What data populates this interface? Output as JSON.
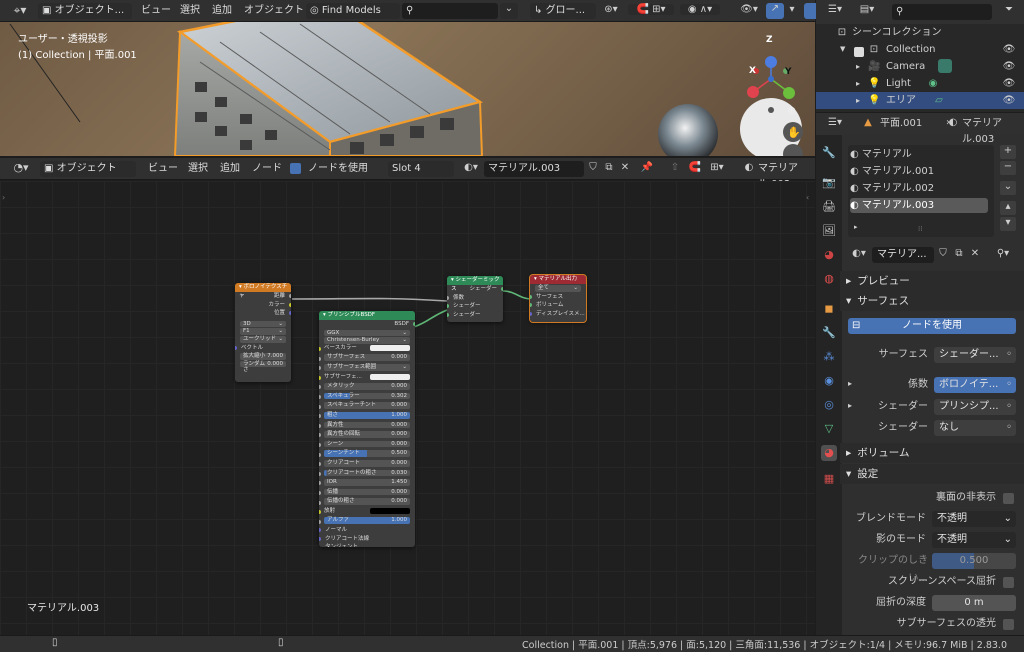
{
  "top_header": {
    "mode": "オブジェクト...",
    "menus": [
      "ビュー",
      "選択",
      "追加",
      "オブジェクト"
    ],
    "find_models": "Find Models",
    "transform": "グロー..."
  },
  "viewport": {
    "title": "ユーザー・透視投影",
    "collection": "(1) Collection | 平面.001",
    "gizmo_z": "Z",
    "gizmo_y": "Y",
    "gizmo_x": "X"
  },
  "node_header": {
    "mode": "オブジェクト",
    "menus": [
      "ビュー",
      "選択",
      "追加",
      "ノード"
    ],
    "use_nodes": "ノードを使用",
    "slot": "Slot 4",
    "material": "マテリアル.003",
    "material_right": "マテリアル.003"
  },
  "node_editor": {
    "material_label": "マテリアル.003",
    "voronoi": {
      "title": "ボロノイテクスチャ",
      "outputs": [
        "距離",
        "カラー",
        "位置"
      ],
      "dims": "3D",
      "metric": "F1",
      "distance": "ユークリッド",
      "vector": "ベクトル",
      "scale_label": "拡大縮小",
      "scale_value": "7.000",
      "random_label": "ランダムさ",
      "random_value": "0.000"
    },
    "mix": {
      "title": "シェーダーミックス",
      "output": "シェーダー",
      "inputs": [
        "係数",
        "シェーダー",
        "シェーダー"
      ]
    },
    "output": {
      "title": "マテリアル出力",
      "target": "全て",
      "inputs": [
        "サーフェス",
        "ボリューム",
        "ディスプレイスメ..."
      ]
    },
    "bsdf": {
      "title": "プリンシプルBSDF",
      "output": "BSDF",
      "dist": "GGX",
      "ss_method": "Christensen-Burley",
      "rows": [
        {
          "label": "ベースカラー",
          "value": "",
          "kind": "color",
          "fill": 0
        },
        {
          "label": "サブサーフェス",
          "value": "0.000",
          "kind": "num",
          "fill": 0
        },
        {
          "label": "サブサーフェス範囲",
          "value": "",
          "kind": "drop",
          "fill": 0
        },
        {
          "label": "サブサーフェ...",
          "value": "",
          "kind": "color",
          "fill": 0
        },
        {
          "label": "メタリック",
          "value": "0.000",
          "kind": "num",
          "fill": 0
        },
        {
          "label": "スペキュラー",
          "value": "0.302",
          "kind": "num",
          "fill": 30
        },
        {
          "label": "スペキュラーチント",
          "value": "0.000",
          "kind": "num",
          "fill": 0
        },
        {
          "label": "粗さ",
          "value": "1.000",
          "kind": "num",
          "fill": 100
        },
        {
          "label": "異方性",
          "value": "0.000",
          "kind": "num",
          "fill": 0
        },
        {
          "label": "異方性の回転",
          "value": "0.000",
          "kind": "num",
          "fill": 0
        },
        {
          "label": "シーン",
          "value": "0.000",
          "kind": "num",
          "fill": 0
        },
        {
          "label": "シーンチント",
          "value": "0.500",
          "kind": "num",
          "fill": 50
        },
        {
          "label": "クリアコート",
          "value": "0.000",
          "kind": "num",
          "fill": 0
        },
        {
          "label": "クリアコートの粗さ",
          "value": "0.030",
          "kind": "num",
          "fill": 3
        },
        {
          "label": "IOR",
          "value": "1.450",
          "kind": "num",
          "fill": 0
        },
        {
          "label": "伝播",
          "value": "0.000",
          "kind": "num",
          "fill": 0
        },
        {
          "label": "伝播の粗さ",
          "value": "0.000",
          "kind": "num",
          "fill": 0
        },
        {
          "label": "放射",
          "value": "",
          "kind": "black",
          "fill": 0
        },
        {
          "label": "アルファ",
          "value": "1.000",
          "kind": "num",
          "fill": 100
        }
      ],
      "extra": [
        "ノーマル",
        "クリアコート法線",
        "タンジェント"
      ]
    }
  },
  "outliner": {
    "header": "シーンコレクション",
    "items": [
      {
        "label": "Collection"
      },
      {
        "label": "Camera"
      },
      {
        "label": "Light"
      },
      {
        "label": "エリア"
      }
    ]
  },
  "properties": {
    "object": "平面.001",
    "material": "マテリアル.003",
    "slots": [
      "マテリアル",
      "マテリアル.001",
      "マテリアル.002",
      "マテリアル.003"
    ],
    "mat_name": "マテリア...",
    "preview": "プレビュー",
    "surface": "サーフェス",
    "use_nodes_btn": "ノードを使用",
    "surface_label": "サーフェス",
    "surface_value": "シェーダー...",
    "fac_label": "係数",
    "fac_value": "ボロノイテ...",
    "shader1_label": "シェーダー",
    "shader1_value": "プリンシプ...",
    "shader2_label": "シェーダー",
    "shader2_value": "なし",
    "volume": "ボリューム",
    "settings": "設定",
    "backface_label": "裏面の非表示",
    "blend_label": "ブレンドモード",
    "blend_value": "不透明",
    "shadow_label": "影のモード",
    "shadow_value": "不透明",
    "clip_label": "クリップのしきい...",
    "clip_value": "0.500",
    "ssr_label": "スクリーンスペース屈折",
    "depth_label": "屈折の深度",
    "depth_value": "0 m",
    "sss_label": "サブサーフェスの透光"
  },
  "statusbar": {
    "text": "Collection | 平面.001 | 頂点:5,976 | 面:5,120 | 三角面:11,536 | オブジェクト:1/4 | メモリ:96.7 MiB | 2.83.0"
  },
  "colors": {
    "accent": "#4772b3",
    "voronoi_header": "#d07a24",
    "shader_header": "#2e8b57",
    "output_header": "#9e2b34"
  }
}
